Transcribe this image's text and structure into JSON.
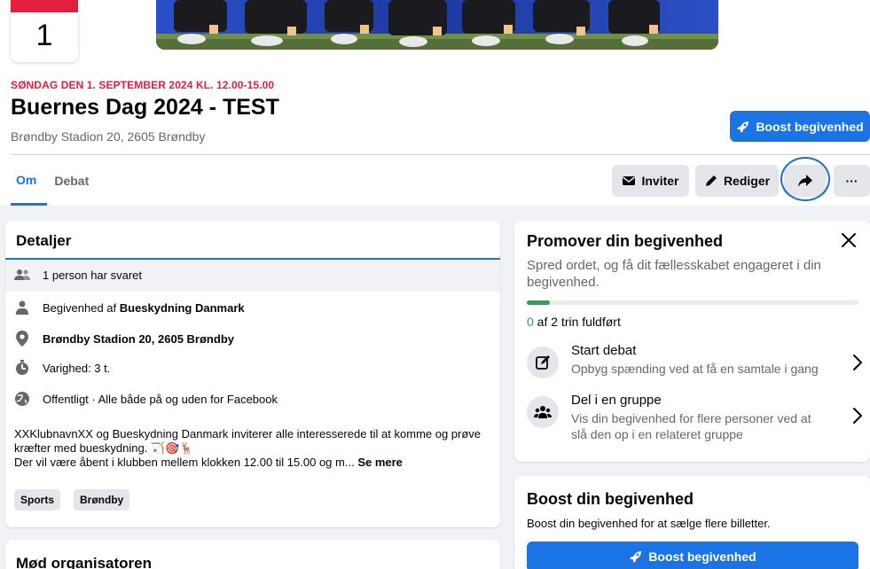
{
  "date_card": {
    "day": "1"
  },
  "event": {
    "date_line": "SØNDAG DEN 1. SEPTEMBER 2024 KL. 12.00-15.00",
    "title": "Buernes Dag 2024 - TEST",
    "location": "Brøndby Stadion 20, 2605 Brøndby"
  },
  "header_actions": {
    "boost_label": "Boost begivenhed",
    "invite_label": "Inviter",
    "edit_label": "Rediger",
    "share_icon": "share-arrow-icon",
    "more_label": "···"
  },
  "tabs": [
    {
      "label": "Om",
      "active": true
    },
    {
      "label": "Debat",
      "active": false
    }
  ],
  "details": {
    "title": "Detaljer",
    "responded": "1 person har svaret",
    "host_prefix": "Begivenhed af ",
    "host_name": "Bueskydning Danmark",
    "location": "Brøndby Stadion 20, 2605 Brøndby",
    "duration": "Varighed: 3 t.",
    "privacy": "Offentligt · Alle både på og uden for Facebook",
    "description_1": "XXKlubnavnXX og Bueskydning Danmark inviterer alle interesserede til at komme og prøve kræfter med bueskydning. 🏹🎯🦌",
    "description_2": "Der vil være åbent i klubben mellem klokken 12.00 til 15.00 og m... ",
    "see_more": "Se mere",
    "tags": [
      "Sports",
      "Brøndby"
    ]
  },
  "organizer": {
    "title": "Mød organisatoren"
  },
  "promote": {
    "title": "Promover din begivenhed",
    "subtitle": "Spred ordet, og få dit fællesskabet engageret i din begivenhed.",
    "progress_fraction": 0.07,
    "steps_done": "0",
    "steps_rest": " af 2 trin fuldført",
    "items": [
      {
        "title": "Start debat",
        "subtitle": "Opbyg spænding ved at få en samtale i gang",
        "icon": "edit-square-icon"
      },
      {
        "title": "Del i en gruppe",
        "subtitle": "Vis din begivenhed for flere personer ved at slå den op i en relateret gruppe",
        "icon": "group-icon"
      }
    ]
  },
  "boost": {
    "title": "Boost din begivenhed",
    "subtitle": "Boost din begivenhed for at sælge flere billetter.",
    "button_label": "Boost begivenhed"
  },
  "colors": {
    "accent": "#1b74e4",
    "date_red": "#e41e3f",
    "progress_green": "#31a24c",
    "page_bg": "#f0f2f5"
  }
}
